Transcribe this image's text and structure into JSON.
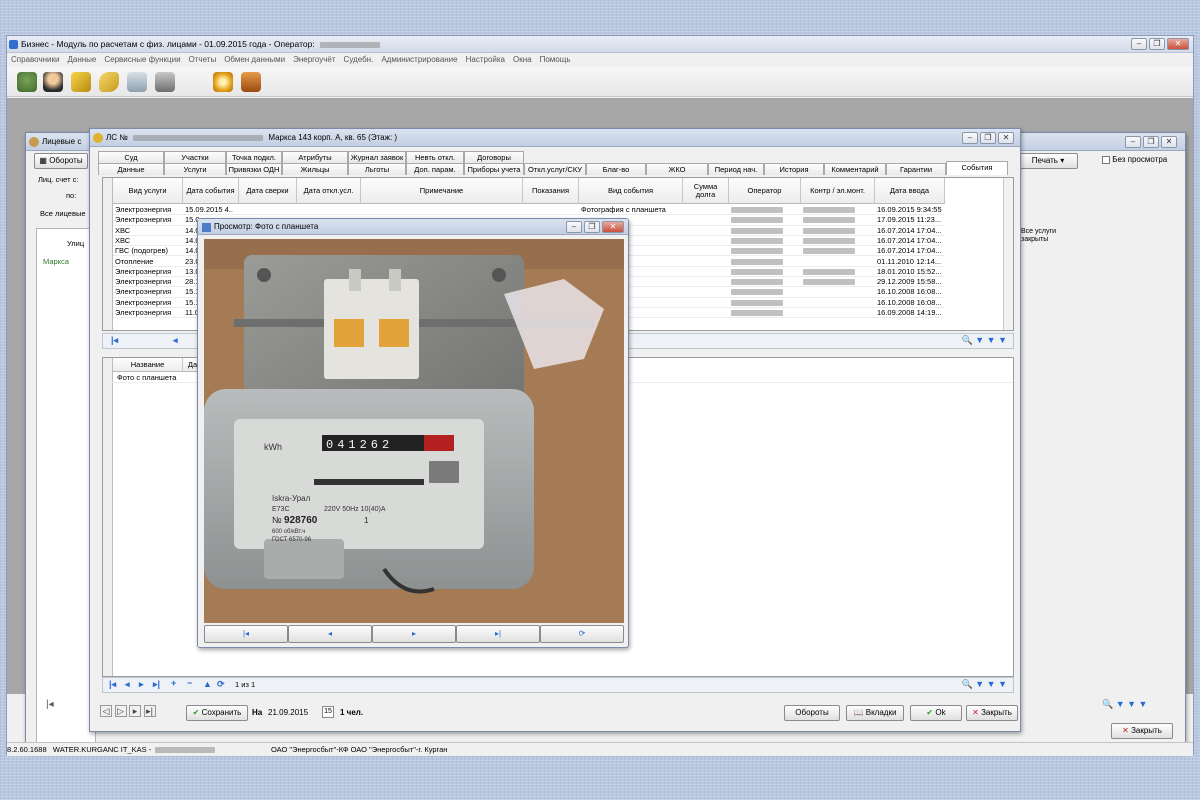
{
  "app": {
    "title": "Бизнес - Модуль по расчетам с физ. лицами - 01.09.2015 года - Оператор:",
    "menu": [
      "Справочники",
      "Данные",
      "Сервисные функции",
      "Отчеты",
      "Обмен данными",
      "Энергоучёт",
      "Судебн.",
      "Администрирование",
      "Настройка",
      "Окна",
      "Помощь"
    ],
    "toolbar_icons": [
      "house-icon",
      "person-icon",
      "notebook-icon",
      "key-icon",
      "calculator-icon",
      "printer-icon",
      "gear-icon",
      "door-exit-icon"
    ]
  },
  "background_window": {
    "title": "Лицевые с",
    "oboroty_button": "Обороты",
    "account_label": "Лиц. счет с:",
    "po_label": "по:",
    "all_accounts": "Все лицевые",
    "street_header": "Улиц",
    "street_value": "Маркса",
    "print_button": "Печать",
    "no_preview_label": "Без просмотра",
    "services_closed": "Все услуги закрыты",
    "close_button": "Закрыть"
  },
  "account_window": {
    "title": "ЛС №",
    "title_suffix": "Маркса 143 корп. А, кв. 65 (Этаж: )",
    "tabs_row1": [
      "Суд",
      "Участки",
      "Точка подкл.",
      "Атрибуты",
      "Журнал заявок",
      "Невть откл.",
      "Договоры"
    ],
    "tabs_row2": [
      "Данные",
      "Услуги",
      "Привязки ОДН",
      "Жильцы",
      "Льготы",
      "Доп. парам.",
      "Приборы учета",
      "Откл.услуг/СКУ",
      "Благ-во",
      "ЖКО",
      "Период нач.",
      "История",
      "Комментарий",
      "Гарантии",
      "События"
    ],
    "active_tab": "События",
    "columns": [
      "Вид услуги",
      "Дата события",
      "Дата сверки",
      "Дата откл.усл.",
      "Примечание",
      "Показания",
      "Вид события",
      "Сумма долга",
      "Оператор",
      "Контр / эл.монт.",
      "Дата ввода"
    ],
    "rows": [
      {
        "service": "Электроэнергия",
        "date": "15.09.2015 4..",
        "event": "Фотография с планшета",
        "entered": "16.09.2015 9:34:55"
      },
      {
        "service": "Электроэнергия",
        "date": "15.0",
        "event": "новлена п...",
        "entered": "17.09.2015 11:23..."
      },
      {
        "service": "ХВС",
        "date": "14.0",
        "event": "ройство",
        "entered": "16.07.2014 17:04..."
      },
      {
        "service": "ХВС",
        "date": "14.0",
        "event": "ответству...",
        "entered": "16.07.2014 17:04..."
      },
      {
        "service": "ГВС (подогрев)",
        "date": "14.0",
        "event": "ответству...",
        "entered": "16.07.2014 17:04..."
      },
      {
        "service": "Отопление",
        "date": "23.0",
        "event": "",
        "entered": "01.11.2010 12:14..."
      },
      {
        "service": "Электроэнергия",
        "date": "13.0",
        "event": "",
        "entered": "18.01.2010 15:52..."
      },
      {
        "service": "Электроэнергия",
        "date": "28.1",
        "event": "",
        "entered": "29.12.2009 15:58..."
      },
      {
        "service": "Электроэнергия",
        "date": "15.1",
        "event": "ти",
        "entered": "16.10.2008 16:08..."
      },
      {
        "service": "Электроэнергия",
        "date": "15.1",
        "event": "нистек ме...",
        "entered": "16.10.2008 16:08..."
      },
      {
        "service": "Электроэнергия",
        "date": "11.0",
        "event": "ание",
        "entered": "16.09.2008 14:19..."
      }
    ],
    "sub_columns": [
      "Название",
      "Да"
    ],
    "sub_rows": [
      "Фото с планшета"
    ],
    "record_counter": "1 из 1",
    "save_button": "Сохранить",
    "on_label": "На",
    "date_value": "21.09.2015",
    "people_count": "1 чел.",
    "oboroty_button": "Обороты",
    "tabs_button": "Вкладки",
    "ok_button": "Ok",
    "close_button": "Закрыть"
  },
  "preview_window": {
    "title": "Просмотр: Фото с планшета",
    "meter": {
      "reading": "041262",
      "unit": "kWh",
      "brand": "Iskra-Урал",
      "model": "E73C",
      "specs": "220V 50Hz 10(40)A",
      "serial_prefix": "№",
      "serial": "928760",
      "class": "1",
      "rate": "600 об/кВт.ч",
      "standard": "ГОСТ 6570-96"
    },
    "nav_icons": [
      "first-icon",
      "prev-icon",
      "next-icon",
      "last-icon",
      "rotate-icon"
    ]
  },
  "statusbar": {
    "version": "8.2.60.1688",
    "server": "WATER.KURGANC IT_KAS -",
    "org": "ОАО \"Энергосбыт\"-КФ ОАО \"Энергосбыт\"-г. Курган"
  }
}
